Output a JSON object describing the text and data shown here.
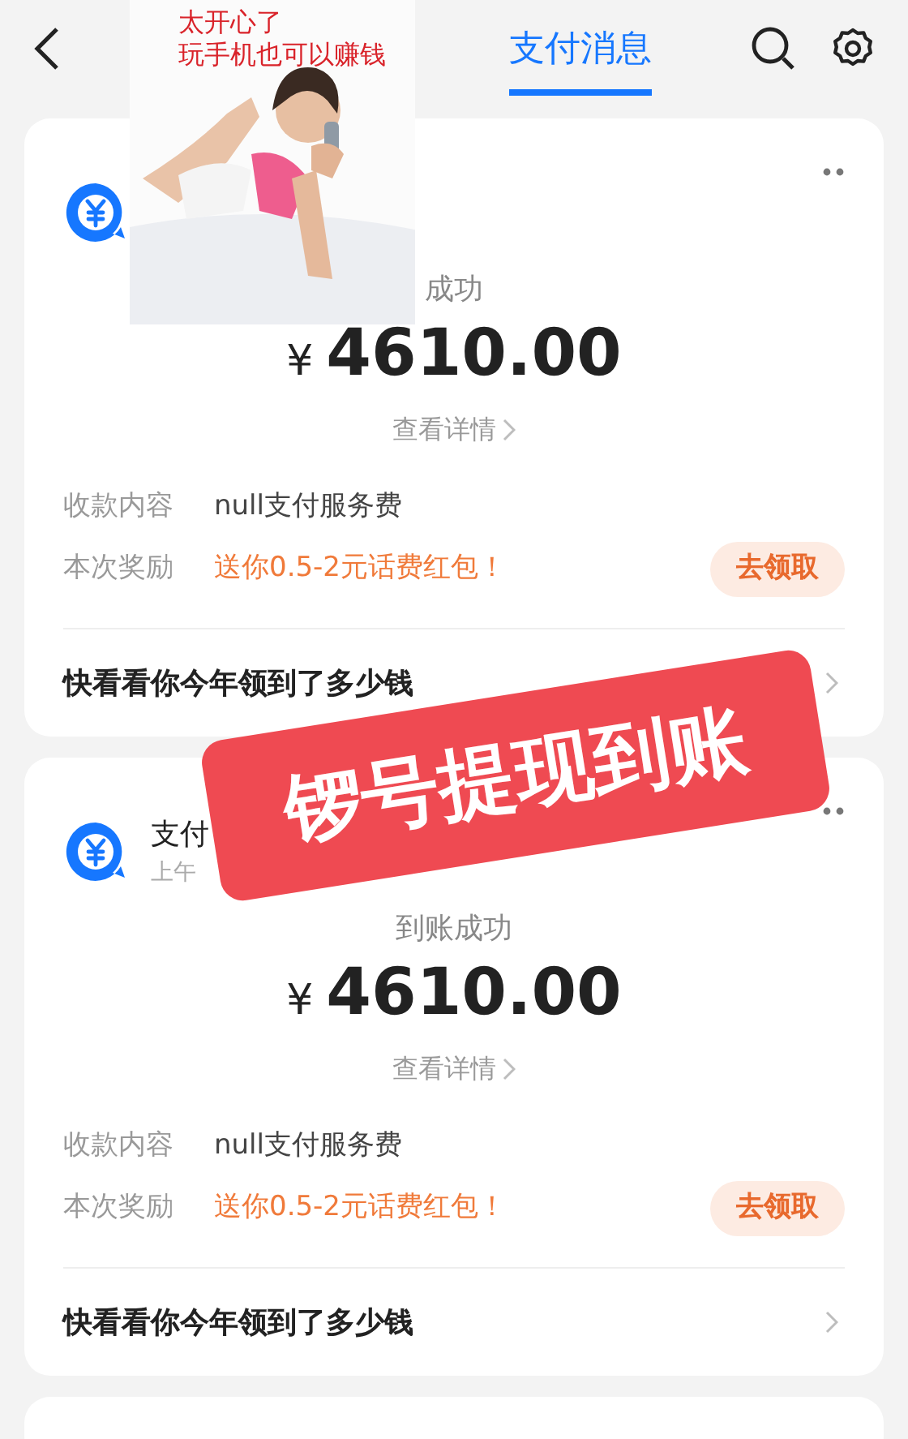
{
  "header": {
    "tabs": [
      {
        "label": "支付消息",
        "selected": true
      }
    ]
  },
  "cards": [
    {
      "status": "成功",
      "amount": "4610.00",
      "currency": "¥",
      "details_link": "查看详情",
      "rows": [
        {
          "label": "收款内容",
          "value": "null支付服务费",
          "kind": "plain"
        },
        {
          "label": "本次奖励",
          "value": "送你0.5-2元话费红包！",
          "kind": "promo"
        }
      ],
      "button": "去领取",
      "footer_link": "快看看你今年领到了多少钱"
    },
    {
      "title": "支付",
      "time": "上午",
      "status": "到账成功",
      "amount": "4610.00",
      "currency": "¥",
      "details_link": "查看详情",
      "rows": [
        {
          "label": "收款内容",
          "value": "null支付服务费",
          "kind": "plain"
        },
        {
          "label": "本次奖励",
          "value": "送你0.5-2元话费红包！",
          "kind": "promo"
        }
      ],
      "button": "去领取",
      "footer_link": "快看看你今年领到了多少钱"
    }
  ],
  "ad_overlay": {
    "kind": "picture",
    "caption": [
      "太开心了",
      "玩手机也可以赚钱"
    ]
  },
  "stamp": {
    "text": "锣号提现到账"
  }
}
